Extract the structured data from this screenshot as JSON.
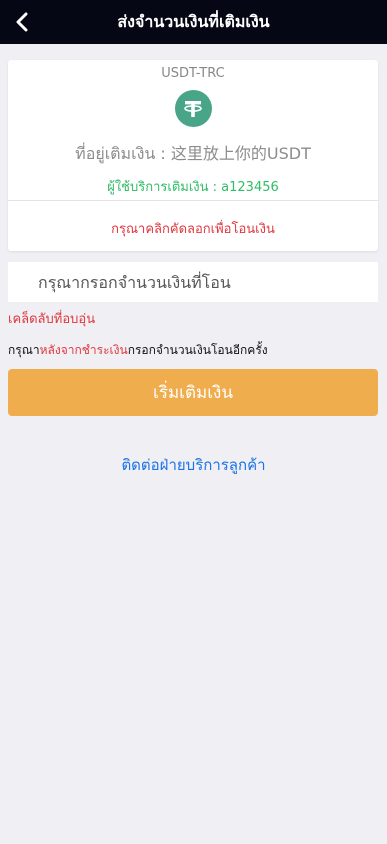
{
  "header": {
    "title": "ส่งจำนวนเงินที่เติมเงิน"
  },
  "card": {
    "network": "USDT-TRC",
    "icon": "tether-icon",
    "address_line": "ที่อยู่เติมเงิน : 这里放上你的USDT",
    "provider_line": "ผู้ใช้บริการเติมเงิน : a123456",
    "copy_hint": "กรุณาคลิกคัดลอกเพื่อโอนเงิน"
  },
  "amount": {
    "placeholder": "กรุณากรอกจำนวนเงินที่โอน",
    "value": ""
  },
  "tips_link": "เคล็ดลับที่อบอุ่น",
  "instruction": {
    "prefix": "กรุณา",
    "highlight": "หลังจากชำระเงิน",
    "suffix": "กรอกจำนวนเงินโอนอีกครั้ง"
  },
  "submit_label": "เริ่มเติมเงิน",
  "support_link": "ติดต่อฝ่ายบริการลูกค้า",
  "colors": {
    "header_bg": "#050714",
    "accent": "#f0ad4e",
    "warning": "#e0383f",
    "success": "#2fbd66",
    "link": "#1a73e8",
    "tether": "#48a588"
  }
}
